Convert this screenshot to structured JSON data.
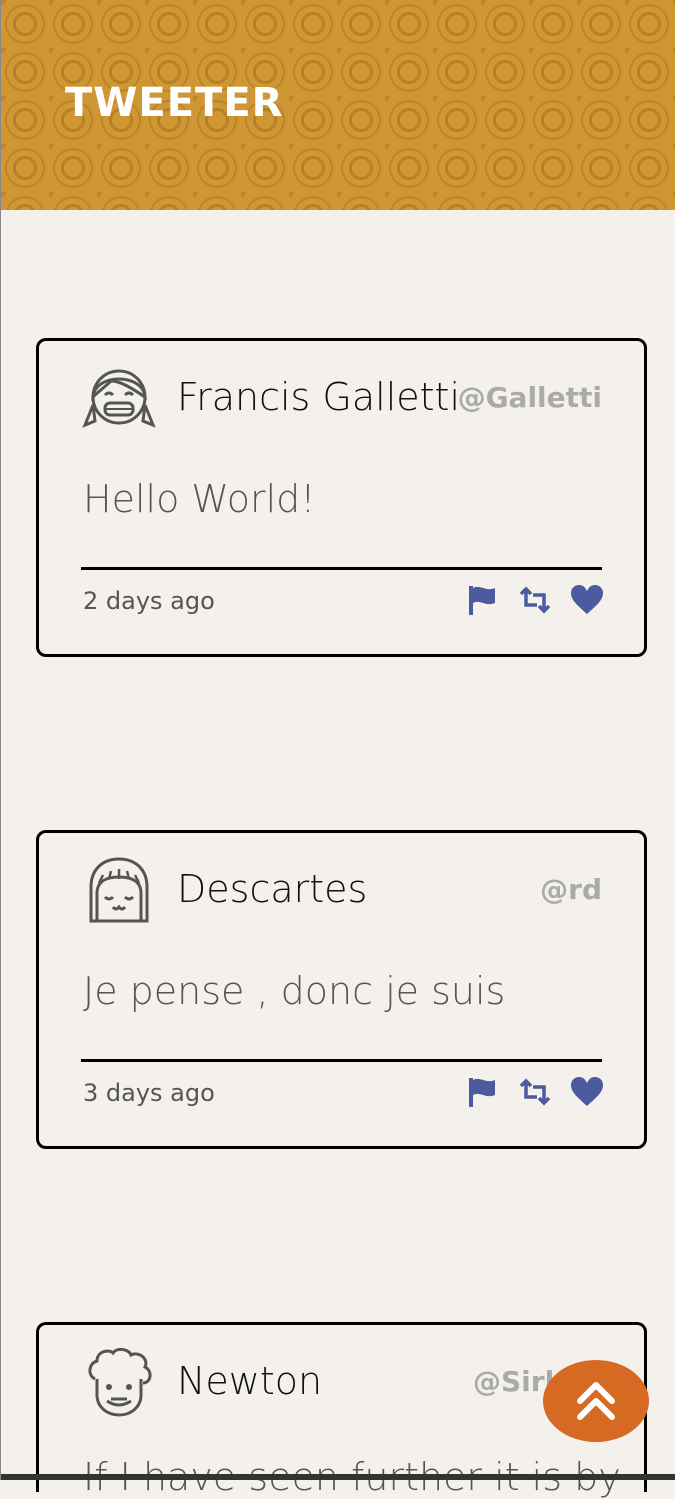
{
  "brand": "TWEETER",
  "tweets": [
    {
      "name": "Francis Galletti",
      "handle": "@Galletti",
      "text": "Hello World!",
      "time": "2 days ago",
      "avatar": "girl-grin-avatar"
    },
    {
      "name": "Descartes",
      "handle": "@rd",
      "text": "Je pense , donc je suis",
      "time": "3 days ago",
      "avatar": "bob-hair-avatar"
    },
    {
      "name": "Newton",
      "handle": "@Sirl",
      "text": "If I have seen further it is by",
      "time": "",
      "avatar": "curly-hair-avatar"
    }
  ],
  "actions": {
    "flag_icon": "flag-icon",
    "retweet_icon": "retweet-icon",
    "heart_icon": "heart-icon",
    "icon_color": "#4c5b9f"
  },
  "scroll_top_icon": "double-chevron-up-icon"
}
